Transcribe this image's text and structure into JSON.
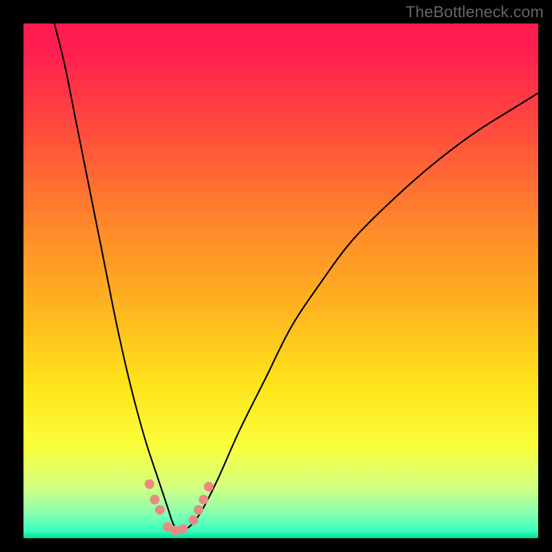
{
  "watermark": "TheBottleneck.com",
  "chart_data": {
    "type": "line",
    "title": "",
    "xlabel": "",
    "ylabel": "",
    "xlim": [
      0,
      100
    ],
    "ylim": [
      0,
      100
    ],
    "grid": false,
    "legend": false,
    "gradient_stops": [
      {
        "offset": 0.0,
        "color": "#ff1a4d"
      },
      {
        "offset": 0.06,
        "color": "#ff2050"
      },
      {
        "offset": 0.2,
        "color": "#ff4a3e"
      },
      {
        "offset": 0.4,
        "color": "#ff8a2a"
      },
      {
        "offset": 0.55,
        "color": "#ffb41f"
      },
      {
        "offset": 0.7,
        "color": "#ffe31a"
      },
      {
        "offset": 0.82,
        "color": "#faff3a"
      },
      {
        "offset": 0.9,
        "color": "#d3ff80"
      },
      {
        "offset": 0.95,
        "color": "#8bffb0"
      },
      {
        "offset": 0.985,
        "color": "#3affc0"
      },
      {
        "offset": 1.0,
        "color": "#00e090"
      }
    ],
    "series": [
      {
        "name": "bottleneck-curve",
        "type": "line",
        "x": [
          6,
          8,
          10,
          12,
          14,
          16,
          18,
          20,
          22,
          24,
          26,
          28,
          29,
          30,
          31,
          33,
          35,
          38,
          42,
          47,
          52,
          58,
          64,
          72,
          80,
          88,
          96,
          100
        ],
        "y": [
          100,
          92,
          82,
          72,
          62,
          52,
          42,
          33,
          25,
          18,
          12,
          6,
          3,
          1.4,
          1.4,
          3,
          6,
          12,
          21,
          31,
          41,
          50,
          58,
          66,
          73,
          79,
          84,
          86.5
        ]
      }
    ],
    "curve_min": {
      "x": 29.5,
      "y": 1.4
    },
    "data_points": [
      {
        "x": 24.5,
        "y": 10.5
      },
      {
        "x": 25.5,
        "y": 7.5
      },
      {
        "x": 26.5,
        "y": 5.5
      },
      {
        "x": 28.0,
        "y": 2.2
      },
      {
        "x": 29.5,
        "y": 1.5
      },
      {
        "x": 31.0,
        "y": 1.8
      },
      {
        "x": 33.0,
        "y": 3.5
      },
      {
        "x": 34.0,
        "y": 5.5
      },
      {
        "x": 35.0,
        "y": 7.5
      },
      {
        "x": 36.0,
        "y": 10.0
      }
    ],
    "point_color": "#e88b82",
    "curve_color": "#000000",
    "curve_width": 2.2,
    "point_radius": 7
  }
}
